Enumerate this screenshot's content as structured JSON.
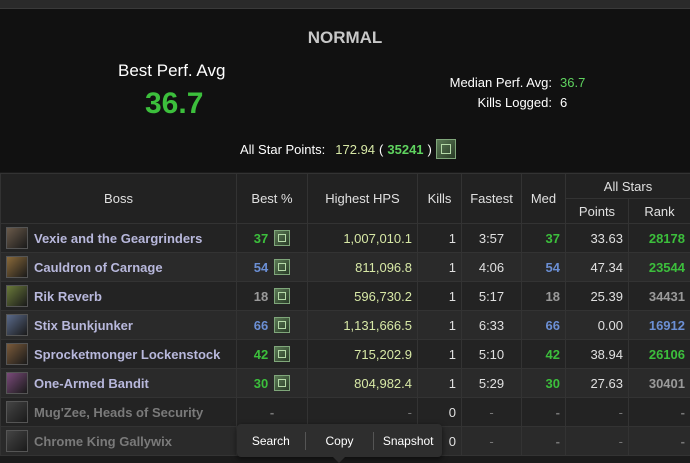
{
  "summary": {
    "difficulty": "NORMAL",
    "best_perf_label": "Best Perf. Avg",
    "best_perf_value": "36.7",
    "median_label": "Median Perf. Avg:",
    "median_value": "36.7",
    "kills_label": "Kills Logged:",
    "kills_value": "6",
    "allstar_label": "All Star Points:",
    "allstar_points": "172.94",
    "allstar_open": "(",
    "allstar_rank": "35241",
    "allstar_close": ")"
  },
  "table": {
    "headers": {
      "boss": "Boss",
      "best": "Best %",
      "hps": "Highest HPS",
      "kills": "Kills",
      "fastest": "Fastest",
      "med": "Med",
      "allstars": "All Stars",
      "points": "Points",
      "rank": "Rank"
    },
    "rows": [
      {
        "boss": "Vexie and the Geargrinders",
        "best": "37",
        "hps": "1,007,010.1",
        "kills": "1",
        "fastest": "3:57",
        "med": "37",
        "points": "33.63",
        "rank": "28178",
        "color": "green",
        "rank_color": "green",
        "portrait": "#6a5a4a",
        "dim": false
      },
      {
        "boss": "Cauldron of Carnage",
        "best": "54",
        "hps": "811,096.8",
        "kills": "1",
        "fastest": "4:06",
        "med": "54",
        "points": "47.34",
        "rank": "23544",
        "color": "blue",
        "rank_color": "green",
        "portrait": "#8a6a3a",
        "dim": false
      },
      {
        "boss": "Rik Reverb",
        "best": "18",
        "hps": "596,730.2",
        "kills": "1",
        "fastest": "5:17",
        "med": "18",
        "points": "25.39",
        "rank": "34431",
        "color": "grey",
        "rank_color": "grey",
        "portrait": "#6a7a3a",
        "dim": false
      },
      {
        "boss": "Stix Bunkjunker",
        "best": "66",
        "hps": "1,131,666.5",
        "kills": "1",
        "fastest": "6:33",
        "med": "66",
        "points": "0.00",
        "rank": "16912",
        "color": "blue",
        "rank_color": "blue",
        "portrait": "#5a6a8a",
        "dim": false
      },
      {
        "boss": "Sprocketmonger Lockenstock",
        "best": "42",
        "hps": "715,202.9",
        "kills": "1",
        "fastest": "5:10",
        "med": "42",
        "points": "38.94",
        "rank": "26106",
        "color": "green",
        "rank_color": "green",
        "portrait": "#7a5a3a",
        "dim": false
      },
      {
        "boss": "One-Armed Bandit",
        "best": "30",
        "hps": "804,982.4",
        "kills": "1",
        "fastest": "5:29",
        "med": "30",
        "points": "27.63",
        "rank": "30401",
        "color": "green",
        "rank_color": "grey",
        "portrait": "#7a4a7a",
        "dim": false
      },
      {
        "boss": "Mug'Zee, Heads of Security",
        "best": "-",
        "hps": "-",
        "kills": "0",
        "fastest": "-",
        "med": "-",
        "points": "-",
        "rank": "-",
        "color": "dash",
        "rank_color": "dash",
        "portrait": "#444444",
        "dim": true
      },
      {
        "boss": "Chrome King Gallywix",
        "best": "-",
        "hps": "-",
        "kills": "0",
        "fastest": "-",
        "med": "-",
        "points": "-",
        "rank": "-",
        "color": "dash",
        "rank_color": "dash",
        "portrait": "#444444",
        "dim": true
      }
    ]
  },
  "toolbar": {
    "search": "Search",
    "copy": "Copy",
    "snapshot": "Snapshot"
  }
}
